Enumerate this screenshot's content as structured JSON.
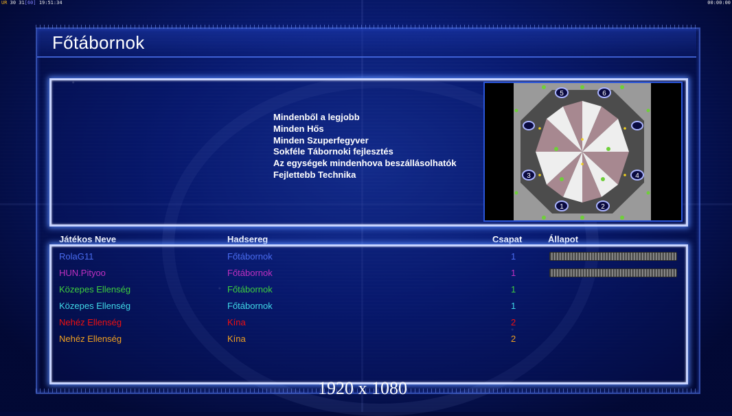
{
  "statusbar": {
    "ur": "UR",
    "stats": "30 31",
    "fps": "[60]",
    "clock": "19:51:34",
    "timer": "00:00:00"
  },
  "title": "Főtábornok",
  "description": [
    "Mindenből a legjobb",
    "Minden Hős",
    "Minden Szuperfegyver",
    "Sokféle Tábornoki fejlesztés",
    "Az egységek mindenhova beszállásolhatók",
    "Fejlettebb Technika"
  ],
  "minimap": {
    "start_positions": [
      "1",
      "2",
      "3",
      "4",
      "5",
      "6"
    ]
  },
  "table": {
    "headers": {
      "player": "Játékos Neve",
      "army": "Hadsereg",
      "team": "Csapat",
      "status": "Állapot"
    },
    "rows": [
      {
        "name": "RolaG11",
        "army": "Főtábornok",
        "team": "1",
        "color": "#4a6cf0",
        "has_slot_bar": true
      },
      {
        "name": "HUN.Pityoo",
        "army": "Főtábornok",
        "team": "1",
        "color": "#c030c0",
        "has_slot_bar": true
      },
      {
        "name": "Közepes Ellenség",
        "army": "Főtábornok",
        "team": "1",
        "color": "#3ecf3e",
        "has_slot_bar": false
      },
      {
        "name": "Közepes Ellenség",
        "army": "Főtábornok",
        "team": "1",
        "color": "#40d8e8",
        "has_slot_bar": false
      },
      {
        "name": "Nehéz Ellenség",
        "army": "Kína",
        "team": "2",
        "color": "#f01010",
        "has_slot_bar": false
      },
      {
        "name": "Nehéz Ellenség",
        "army": "Kína",
        "team": "2",
        "color": "#f0a020",
        "has_slot_bar": false
      }
    ]
  },
  "resolution": "1920 x 1080"
}
